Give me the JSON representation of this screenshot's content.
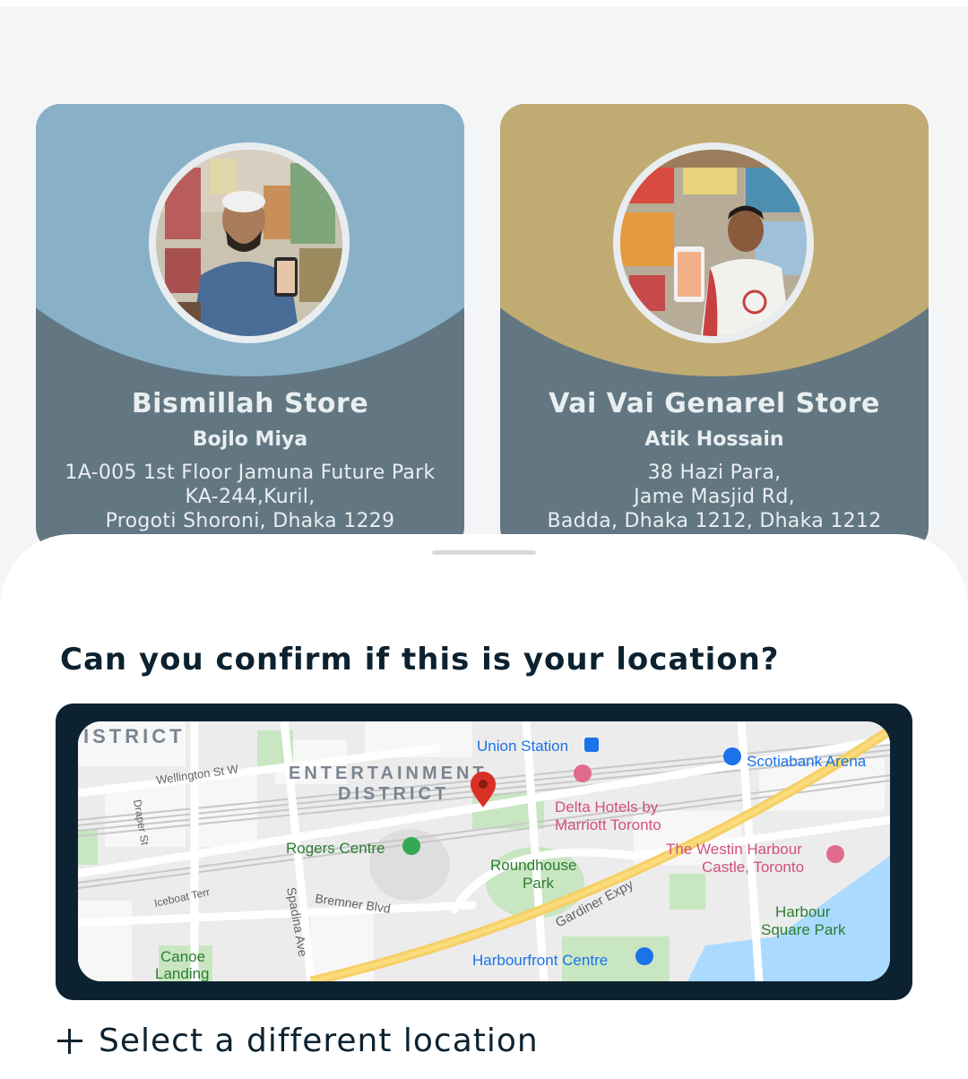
{
  "stores": [
    {
      "name": "Bismillah Store",
      "owner": "Bojlo Miya",
      "address": [
        "1A-005 1st Floor Jamuna Future Park",
        "KA-244,Kuril,",
        "Progoti Shoroni, Dhaka 1229"
      ],
      "color": "#88b1c8"
    },
    {
      "name": "Vai Vai Genarel Store",
      "owner": "Atik Hossain",
      "address": [
        "38 Hazi Para,",
        "Jame Masjid Rd,",
        "Badda, Dhaka 1212, Dhaka 1212"
      ],
      "color": "#c0ab72"
    }
  ],
  "sheet": {
    "question": "Can you confirm if this is your location?",
    "select_label": "Select a different location",
    "select_icon": "plus-icon"
  },
  "map": {
    "labels": {
      "district_top": "ISTRICT",
      "wellington": "Wellington St W",
      "draper": "Draper St",
      "entertainment": "ENTERTAINMENT",
      "district": "DISTRICT",
      "union_station": "Union Station",
      "scotiabank": "Scotiabank Arena",
      "delta_1": "Delta Hotels by",
      "delta_2": "Marriott Toronto",
      "rogers": "Rogers Centre",
      "roundhouse_1": "Roundhouse",
      "roundhouse_2": "Park",
      "westin_1": "The Westin Harbour",
      "westin_2": "Castle, Toronto",
      "iceboat": "Iceboat Terr",
      "bremner": "Bremner Blvd",
      "spadina": "Spadina Ave",
      "gardiner": "Gardiner Expy",
      "harbour_1": "Harbour",
      "harbour_2": "Square Park",
      "canoe_1": "Canoe",
      "canoe_2": "Landing",
      "harbourfront": "Harbourfront Centre"
    },
    "pin_color": "#d93025"
  }
}
